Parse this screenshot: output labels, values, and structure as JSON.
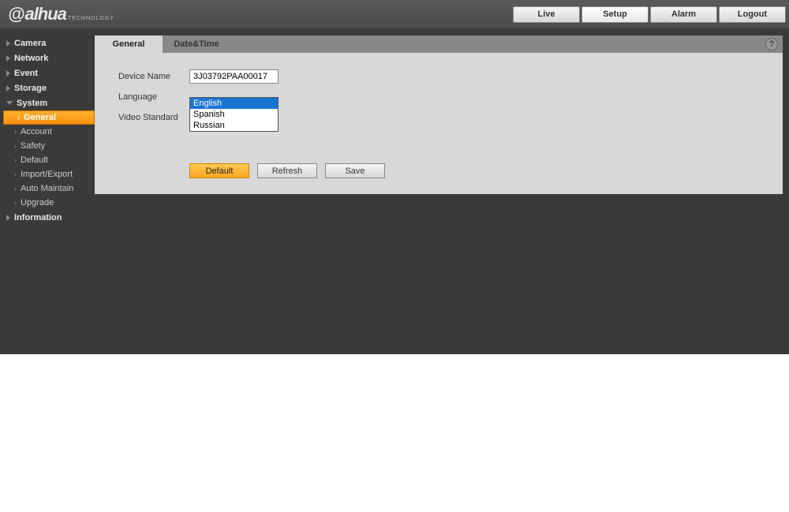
{
  "brand": {
    "name": "alhua",
    "sub": "TECHNOLOGY"
  },
  "topNav": {
    "live": "Live",
    "setup": "Setup",
    "alarm": "Alarm",
    "logout": "Logout"
  },
  "sidebar": {
    "camera": "Camera",
    "network": "Network",
    "event": "Event",
    "storage": "Storage",
    "system": "System",
    "systemSub": {
      "general": "General",
      "account": "Account",
      "safety": "Safety",
      "default": "Default",
      "importExport": "Import/Export",
      "autoMaintain": "Auto Maintain",
      "upgrade": "Upgrade"
    },
    "information": "Information"
  },
  "tabs": {
    "general": "General",
    "dateTime": "Date&Time"
  },
  "form": {
    "deviceNameLabel": "Device Name",
    "deviceNameValue": "3J03792PAA00017",
    "languageLabel": "Language",
    "videoStandardLabel": "Video Standard",
    "languageOptions": {
      "english": "English",
      "spanish": "Spanish",
      "russian": "Russian"
    }
  },
  "buttons": {
    "default": "Default",
    "refresh": "Refresh",
    "save": "Save"
  },
  "helpIcon": "?"
}
